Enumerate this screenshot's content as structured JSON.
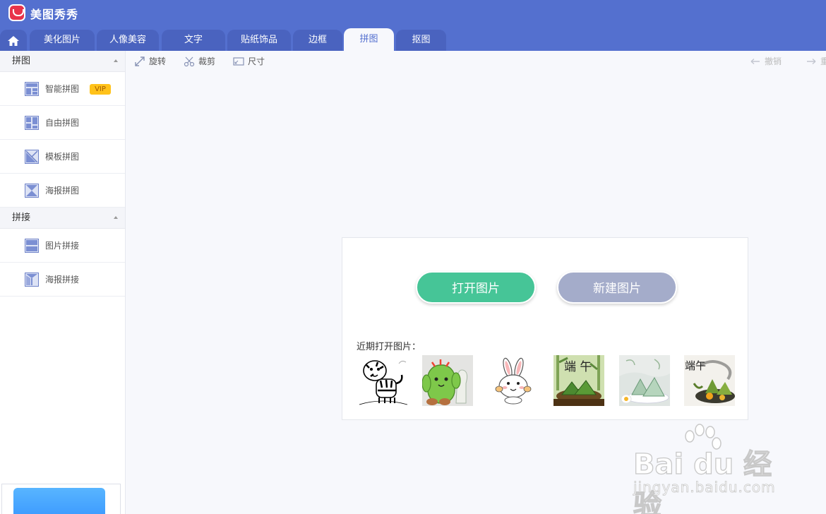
{
  "app": {
    "title": "美图秀秀"
  },
  "tabs": [
    "美化图片",
    "人像美容",
    "文字",
    "贴纸饰品",
    "边框",
    "拼图",
    "抠图"
  ],
  "active_tab": "拼图",
  "sidebar": {
    "sections": [
      {
        "title": "拼图",
        "items": [
          {
            "label": "智能拼图",
            "badge": "VIP",
            "icon": "smart-collage-icon"
          },
          {
            "label": "自由拼图",
            "icon": "free-collage-icon"
          },
          {
            "label": "模板拼图",
            "icon": "template-collage-icon"
          },
          {
            "label": "海报拼图",
            "icon": "poster-collage-icon"
          }
        ]
      },
      {
        "title": "拼接",
        "items": [
          {
            "label": "图片拼接",
            "icon": "image-stitch-icon"
          },
          {
            "label": "海报拼接",
            "icon": "poster-stitch-icon"
          }
        ]
      }
    ]
  },
  "toolbar": {
    "rotate": "旋转",
    "crop": "裁剪",
    "size": "尺寸",
    "undo": "撤销",
    "redo": "重"
  },
  "main": {
    "open_button": "打开图片",
    "new_button": "新建图片",
    "recent_label": "近期打开图片：",
    "recent_images": [
      "tiger line drawing",
      "cactus cartoon",
      "rabbit cartoon",
      "端午 zongzi",
      "zongzi plate",
      "端午 ink painting"
    ]
  },
  "thumb_text": {
    "duanwu1": "端 午",
    "duanwu2": "端午"
  },
  "watermark": {
    "text": "Bai du 经验",
    "sub": "jingyan.baidu.com"
  },
  "colors": {
    "header": "#5470cf",
    "open_button": "#46c597",
    "new_button": "#a4acca",
    "vip": "#ffc21a"
  }
}
